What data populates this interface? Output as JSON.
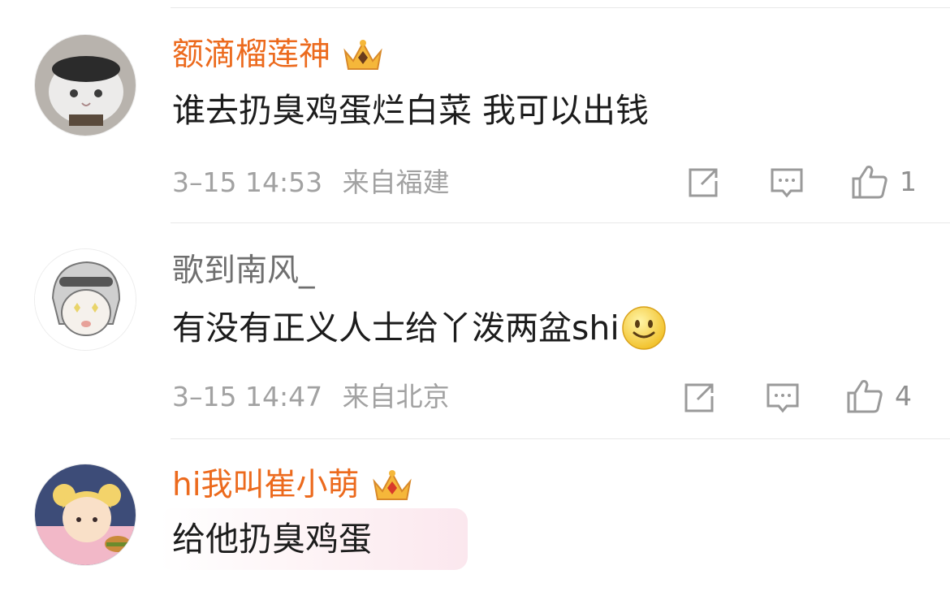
{
  "comments": [
    {
      "username": "额滴榴莲神",
      "user_vip": true,
      "text": "谁去扔臭鸡蛋烂白菜 我可以出钱",
      "time": "3–15 14:53",
      "location": "来自福建",
      "likes": "1"
    },
    {
      "username": "歌到南风_",
      "user_vip": false,
      "text": "有没有正义人士给丫泼两盆shi",
      "emoji": "smile-emoji",
      "time": "3–15 14:47",
      "location": "来自北京",
      "likes": "4"
    },
    {
      "username": "hi我叫崔小萌",
      "user_vip": true,
      "text": "给他扔臭鸡蛋"
    }
  ],
  "colors": {
    "vip_name": "#ec6a1d",
    "plain_name": "#6f6f6f",
    "body_text": "#1c1c1c",
    "meta_text": "#a2a2a2",
    "icon": "#9a9a9a",
    "divider": "#e8e8e8"
  },
  "icons": [
    "share-icon",
    "reply-icon",
    "like-icon",
    "crown-badge-icon",
    "smile-emoji"
  ]
}
